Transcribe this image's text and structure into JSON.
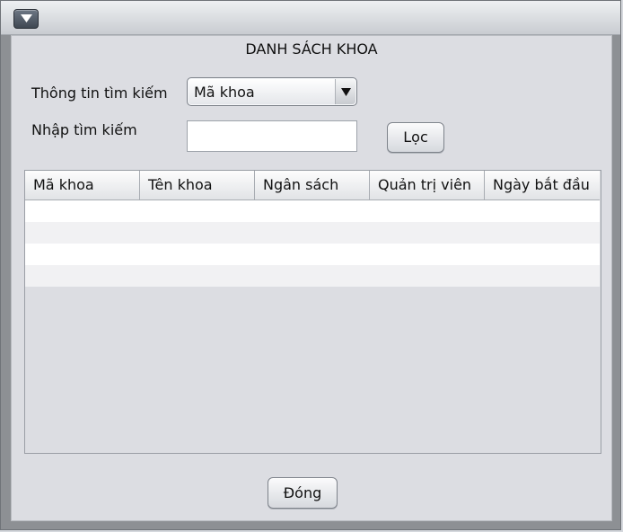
{
  "window": {
    "menu_icon": "triangle-down-icon"
  },
  "dialog": {
    "title": "DANH SÁCH KHOA"
  },
  "search": {
    "criteria_label": "Thông tin tìm kiếm",
    "criteria_selected": "Mã khoa",
    "input_label": "Nhập tìm kiếm",
    "input_value": "",
    "input_placeholder": "",
    "filter_button": "Lọc"
  },
  "table": {
    "columns": [
      "Mã khoa",
      "Tên khoa",
      "Ngân sách",
      "Quản trị viên",
      "Ngày bắt đầu"
    ],
    "rows": []
  },
  "footer": {
    "close_button": "Đóng"
  },
  "colors": {
    "window_background": "#dcdde2",
    "row_white": "#ffffff",
    "row_alt": "#f1f1f3"
  }
}
